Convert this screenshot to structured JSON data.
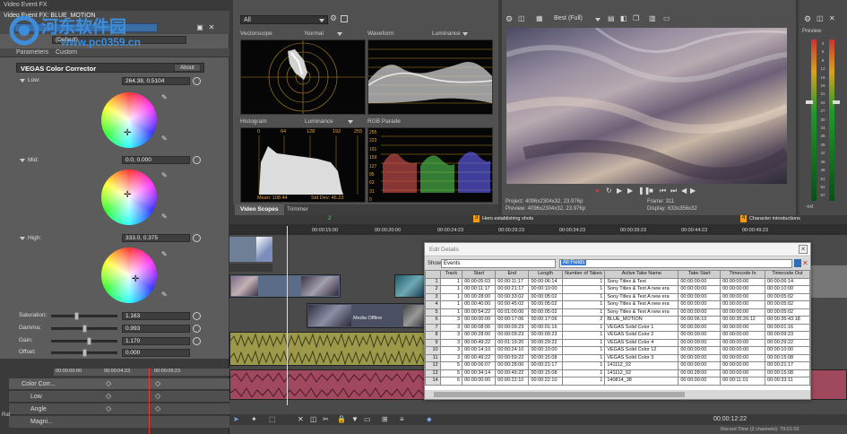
{
  "watermark": {
    "site": "河东软件园",
    "url": "www.pc0359.cn"
  },
  "fx_window": {
    "title": "Video Event FX",
    "chain_title": "Video Event FX: BLUE_MOTION",
    "preset_value": "(Default)",
    "tabs": [
      "Parameters",
      "Custom"
    ],
    "plugin_name": "VEGAS Color Corrector",
    "about_label": "About",
    "low_label": "Low:",
    "low_value": "264.38, 0.5104",
    "mid_label": "Mid:",
    "mid_value": "0.0, 0.000",
    "high_label": "High:",
    "high_value": "333.0, 0.375",
    "saturation_label": "Saturation:",
    "saturation_value": "1.163",
    "gamma_label": "Gamma:",
    "gamma_value": "0.993",
    "gain_label": "Gain:",
    "gain_value": "1.170",
    "offset_label": "Offset:",
    "offset_value": "0.000",
    "keyframe_times": [
      "00:00:00:00",
      "00:00:04:23",
      "00:00:09:23"
    ],
    "keyframe_tracks": [
      "Color Corr...",
      "Low",
      "Angle",
      "Magni..."
    ],
    "side_label": "Rat"
  },
  "scopes": {
    "dropdown": "All",
    "vectorscope": {
      "label": "Vectorscope",
      "mode": "Normal"
    },
    "waveform": {
      "label": "Waveform",
      "mode": "Luminance"
    },
    "histogram": {
      "label": "Histogram",
      "mode": "Luminance",
      "ticks": [
        "0",
        "64",
        "128",
        "192",
        "255"
      ],
      "mean": "Mean: 108.44",
      "stddev": "Std Dev: 46.23"
    },
    "rgb_parade": {
      "label": "RGB Parade",
      "ticks": [
        "255",
        "223",
        "191",
        "159",
        "127",
        "95",
        "63",
        "31",
        "0"
      ]
    },
    "tabs": [
      "Video Scopes",
      "Trimmer"
    ]
  },
  "preview": {
    "quality": "Best (Full)",
    "project": "Project:  4096x2304x32, 23.976p",
    "preview_res": "Preview:  4096x2304x32, 23.976p",
    "frame": "Frame:      311",
    "display": "Display:    633x356x32"
  },
  "meter": {
    "label": "Preview",
    "scale": [
      "3",
      "6",
      "9",
      "12",
      "15",
      "18",
      "21",
      "24",
      "27",
      "30",
      "33",
      "36",
      "39",
      "42",
      "45",
      "48",
      "51",
      "54",
      "57"
    ],
    "value": "-Inf."
  },
  "timeline": {
    "ruler": [
      "00:00:15:00",
      "00:00:20:00",
      "00:00:24:23",
      "00:00:29:23",
      "00:00:34:23",
      "00:00:39:23",
      "00:00:44:23",
      "00:00:49:23"
    ],
    "markers": [
      "Hero establishing shots",
      "Character introductions"
    ],
    "marker_numbers": [
      "2",
      "3",
      "4"
    ],
    "media_offline": "Media Offline",
    "timecode": "00:00:12:22",
    "record_time": "Record Time (2 channels): 79:01:03"
  },
  "edit_details": {
    "title": "Edit Details",
    "show_label": "Show:",
    "show_value": "Events",
    "search": "All Fields",
    "columns": [
      "Track",
      "Start",
      "End",
      "Length",
      "Number of Takes",
      "Active Take Name",
      "Take Start",
      "Timecode In",
      "Timecode Out"
    ],
    "rows": [
      [
        "1",
        "1",
        "00:00:05:03",
        "00:00:11:17",
        "00:00:06:14",
        "1",
        "Sony Titles & Text",
        "00:00:00:00",
        "00:00:00:00",
        "00:00:06:14"
      ],
      [
        "2",
        "1",
        "00:00:11:17",
        "00:00:21:17",
        "00:00:10:00",
        "1",
        "Sony Titles & Text A new era",
        "00:00:00:00",
        "00:00:00:00",
        "00:00:10:00"
      ],
      [
        "3",
        "1",
        "00:00:28:00",
        "00:00:33:02",
        "00:00:05:02",
        "1",
        "Sony Titles & Text A new era",
        "00:00:00:00",
        "00:00:00:00",
        "00:00:05:02"
      ],
      [
        "4",
        "1",
        "00:00:40:00",
        "00:00:45:02",
        "00:00:05:02",
        "1",
        "Sony Titles & Text A new era",
        "00:00:00:00",
        "00:00:00:00",
        "00:00:05:02"
      ],
      [
        "5",
        "1",
        "00:00:54:22",
        "00:01:00:00",
        "00:00:05:02",
        "1",
        "Sony Titles & Text A new era",
        "00:00:00:00",
        "00:00:00:00",
        "00:00:05:02"
      ],
      [
        "6",
        "3",
        "00:00:00:00",
        "00:00:17:06",
        "00:00:17:06",
        "2",
        "BLUE_MOTION",
        "00:00:06:10",
        "00:00:35:26:12",
        "00:00:35:43:18"
      ],
      [
        "7",
        "3",
        "00:00:08:06",
        "00:00:09:23",
        "00:00:01:16",
        "1",
        "VEGAS Solid Color 1",
        "00:00:00:00",
        "00:00:00:00",
        "00:00:01:16"
      ],
      [
        "8",
        "3",
        "00:00:28:00",
        "00:00:09:23",
        "00:00:09:23",
        "1",
        "VEGAS Solid Color 2",
        "00:00:00:00",
        "00:00:00:00",
        "00:00:09:23"
      ],
      [
        "9",
        "3",
        "00:00:49:22",
        "00:01:19:20",
        "00:00:29:22",
        "1",
        "VEGAS Solid Color 4",
        "00:00:00:00",
        "00:00:00:00",
        "00:00:29:22"
      ],
      [
        "10",
        "3",
        "00:00:14:10",
        "00:00:24:10",
        "00:00:10:00",
        "1",
        "VEGAS Solid Color 12",
        "00:00:00:00",
        "00:00:00:00",
        "00:00:10:00"
      ],
      [
        "11",
        "3",
        "00:00:49:22",
        "00:00:59:22",
        "00:00:15:08",
        "1",
        "VEGAS Solid Color 3",
        "00:00:00:00",
        "00:00:00:00",
        "00:00:15:08"
      ],
      [
        "12",
        "5",
        "00:00:06:07",
        "00:00:28:00",
        "00:00:21:17",
        "1",
        "141112_02",
        "00:00:00:00",
        "00:00:00:00",
        "00:00:21:17"
      ],
      [
        "13",
        "5",
        "00:00:34:14",
        "00:00:49:22",
        "00:00:15:08",
        "1",
        "141112_02",
        "00:00:28:00",
        "00:00:00:00",
        "00:00:15:08"
      ],
      [
        "14",
        "6",
        "00:00:00:00",
        "00:00:22:10",
        "00:00:22:10",
        "1",
        "140814_38",
        "00:00:00:00",
        "00:00:11:01",
        "00:00:33:11"
      ]
    ]
  },
  "colors": {
    "accent": "#f39c12",
    "panel": "#5c5c5c",
    "audio": "#9c9a4a",
    "audio_pink": "#a0485e"
  }
}
